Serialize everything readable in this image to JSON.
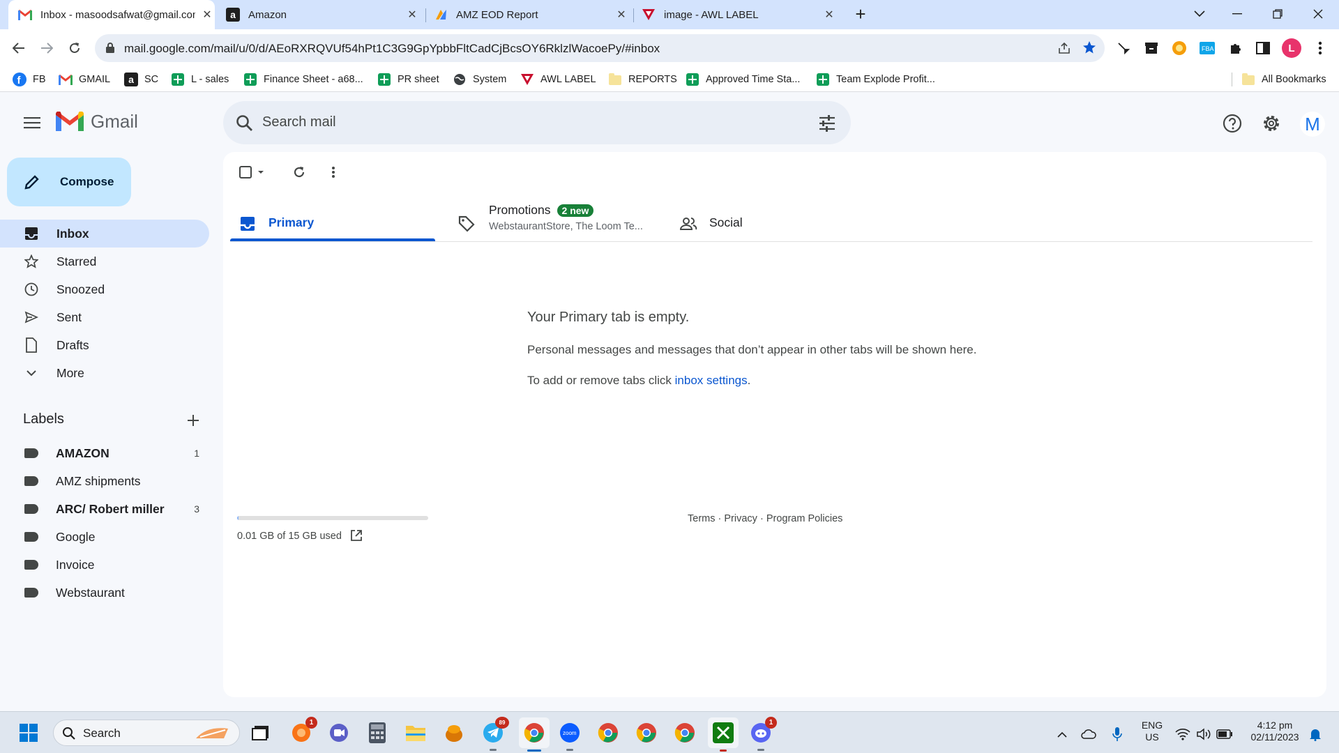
{
  "browser": {
    "tabs": [
      {
        "title": "Inbox - masoodsafwat@gmail.com",
        "active": true
      },
      {
        "title": "Amazon",
        "active": false
      },
      {
        "title": "AMZ EOD Report",
        "active": false
      },
      {
        "title": "image - AWL LABEL",
        "active": false
      }
    ],
    "url": "mail.google.com/mail/u/0/d/AEoRXRQVUf54hPt1C3G9GpYpbbFltCadCjBcsOY6RklzlWacoePy/#inbox",
    "profile_initial": "L",
    "bookmarks": [
      {
        "label": "FB",
        "icon": "facebook-icon"
      },
      {
        "label": "GMAIL",
        "icon": "gmail-icon"
      },
      {
        "label": "SC",
        "icon": "amazon-icon"
      },
      {
        "label": "L - sales",
        "icon": "sheets-icon"
      },
      {
        "label": "Finance Sheet - a68...",
        "icon": "sheets-icon"
      },
      {
        "label": "PR sheet",
        "icon": "sheets-icon"
      },
      {
        "label": "System",
        "icon": "globe-icon"
      },
      {
        "label": "AWL LABEL",
        "icon": "awl-icon"
      },
      {
        "label": "REPORTS",
        "icon": "folder-icon"
      },
      {
        "label": "Approved Time Sta...",
        "icon": "sheets-icon"
      },
      {
        "label": "Team Explode Profit...",
        "icon": "sheets-icon"
      }
    ],
    "all_bookmarks": "All Bookmarks"
  },
  "gmail": {
    "logo_text": "Gmail",
    "search_placeholder": "Search mail",
    "account_initial": "M",
    "compose_label": "Compose",
    "nav": [
      {
        "label": "Inbox",
        "icon": "inbox-icon",
        "active": true
      },
      {
        "label": "Starred",
        "icon": "star-icon"
      },
      {
        "label": "Snoozed",
        "icon": "clock-icon"
      },
      {
        "label": "Sent",
        "icon": "send-icon"
      },
      {
        "label": "Drafts",
        "icon": "draft-icon"
      },
      {
        "label": "More",
        "icon": "chevron-down-icon"
      }
    ],
    "labels_heading": "Labels",
    "labels": [
      {
        "name": "AMAZON",
        "count": "1",
        "bold": true
      },
      {
        "name": "AMZ shipments",
        "count": "",
        "bold": false
      },
      {
        "name": "ARC/ Robert miller",
        "count": "3",
        "bold": true
      },
      {
        "name": "Google",
        "count": "",
        "bold": false
      },
      {
        "name": "Invoice",
        "count": "",
        "bold": false
      },
      {
        "name": "Webstaurant",
        "count": "",
        "bold": false
      }
    ],
    "categories": {
      "primary": "Primary",
      "promotions": "Promotions",
      "promotions_badge": "2 new",
      "promotions_senders": "WebstaurantStore, The Loom Te...",
      "social": "Social"
    },
    "empty": {
      "title": "Your Primary tab is empty.",
      "message": "Personal messages and messages that don’t appear in other tabs will be shown here.",
      "settings_prefix": "To add or remove tabs click ",
      "settings_link": "inbox settings",
      "settings_suffix": "."
    },
    "storage": {
      "text": "0.01 GB of 15 GB used",
      "used_fraction": 0.001
    },
    "footer": {
      "terms": "Terms",
      "privacy": "Privacy",
      "policies": "Program Policies"
    }
  },
  "taskbar": {
    "search_placeholder": "Search",
    "language": "ENG",
    "region": "US",
    "time": "4:12 pm",
    "date": "02/11/2023",
    "badges": {
      "app1": "1",
      "telegram": "89",
      "discord": "1"
    }
  },
  "colors": {
    "accent": "#0b57d0",
    "compose_bg": "#c2e7ff",
    "active_nav": "#d3e3fd",
    "new_badge": "#188038"
  }
}
